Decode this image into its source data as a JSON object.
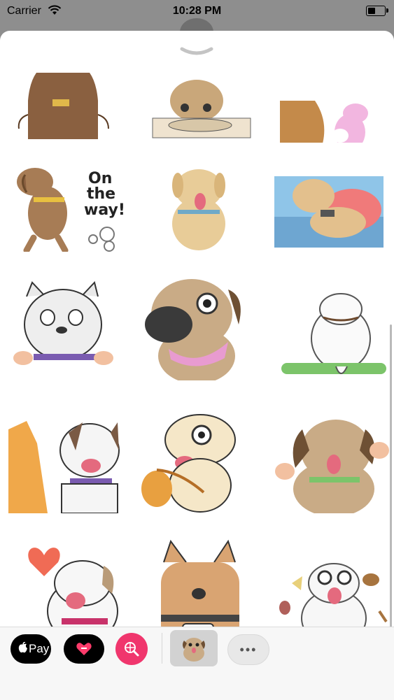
{
  "status_bar": {
    "carrier": "Carrier",
    "time": "10:28 PM"
  },
  "stickers": [
    "brown-dog-back",
    "pug-with-tray",
    "dog-with-pink-bunny",
    "brown-dog-running",
    "yellow-lab-tongue",
    "dog-on-couch",
    "french-bulldog-collar",
    "pug-pink-bib",
    "white-dog-on-mat",
    "dogs-hugging",
    "puppy-with-bag",
    "pug-arms-up",
    "white-dog-heart",
    "brown-dog-coffee",
    "pug-with-food"
  ],
  "sticker_text": {
    "on_the_way": [
      "On",
      "the",
      "way!"
    ]
  },
  "dock": {
    "apple_pay_label": "Pay",
    "more_label": "•••"
  },
  "colors": {
    "search_app": "#f0366d",
    "sheet": "#ffffff",
    "backdrop": "#8e8e8e"
  }
}
